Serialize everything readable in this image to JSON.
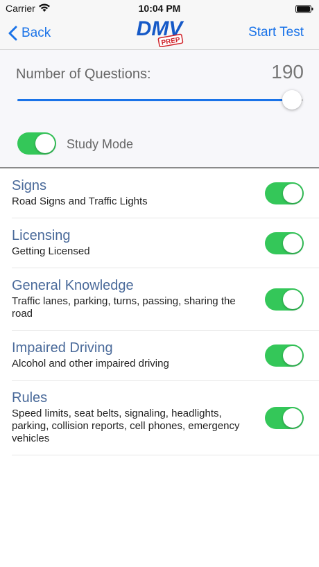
{
  "status": {
    "carrier": "Carrier",
    "time": "10:04 PM"
  },
  "nav": {
    "back_label": "Back",
    "logo_text": "DMV",
    "logo_sub": "PREP",
    "start_label": "Start Test"
  },
  "settings": {
    "questions_label": "Number of Questions:",
    "questions_value": "190",
    "slider_fraction": 0.96,
    "study_mode_label": "Study Mode",
    "study_mode_on": true
  },
  "categories": [
    {
      "title": "Signs",
      "subtitle": "Road Signs and Traffic Lights",
      "enabled": true
    },
    {
      "title": "Licensing",
      "subtitle": "Getting Licensed",
      "enabled": true
    },
    {
      "title": "General Knowledge",
      "subtitle": "Traffic lanes, parking, turns, passing, sharing the road",
      "enabled": true
    },
    {
      "title": "Impaired Driving",
      "subtitle": "Alcohol and other impaired driving",
      "enabled": true
    },
    {
      "title": "Rules",
      "subtitle": "Speed limits, seat belts, signaling, headlights, parking, collision reports, cell phones, emergency vehicles",
      "enabled": true
    }
  ],
  "colors": {
    "accent": "#1a73e8",
    "toggle_on": "#34c759",
    "title_text": "#4a6a9a"
  }
}
